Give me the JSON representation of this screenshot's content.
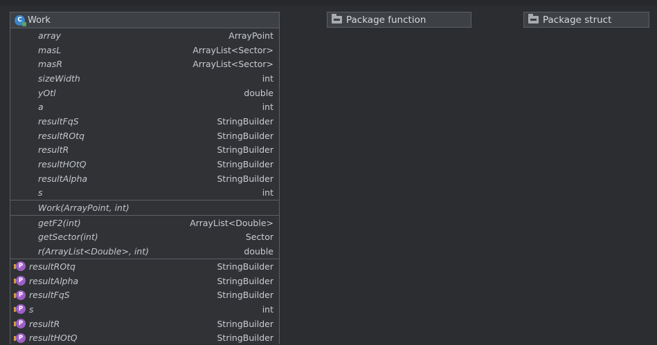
{
  "class": {
    "name": "Work",
    "fields": [
      {
        "name": "array",
        "type": "ArrayPoint"
      },
      {
        "name": "masL",
        "type": "ArrayList<Sector>"
      },
      {
        "name": "masR",
        "type": "ArrayList<Sector>"
      },
      {
        "name": "sizeWidth",
        "type": "int"
      },
      {
        "name": "yOtl",
        "type": "double"
      },
      {
        "name": "a",
        "type": "int"
      },
      {
        "name": "resultFqS",
        "type": "StringBuilder"
      },
      {
        "name": "resultROtq",
        "type": "StringBuilder"
      },
      {
        "name": "resultR",
        "type": "StringBuilder"
      },
      {
        "name": "resultHOtQ",
        "type": "StringBuilder"
      },
      {
        "name": "resultAlpha",
        "type": "StringBuilder"
      },
      {
        "name": "s",
        "type": "int"
      }
    ],
    "constructors": [
      {
        "name": "Work(ArrayPoint, int)",
        "type": ""
      }
    ],
    "methods": [
      {
        "name": "getF2(int)",
        "type": "ArrayList<Double>"
      },
      {
        "name": "getSector(int)",
        "type": "Sector"
      },
      {
        "name": "r(ArrayList<Double>, int)",
        "type": "double"
      }
    ],
    "properties": [
      {
        "name": "resultROtq",
        "type": "StringBuilder"
      },
      {
        "name": "resultAlpha",
        "type": "StringBuilder"
      },
      {
        "name": "resultFqS",
        "type": "StringBuilder"
      },
      {
        "name": "s",
        "type": "int"
      },
      {
        "name": "resultR",
        "type": "StringBuilder"
      },
      {
        "name": "resultHOtQ",
        "type": "StringBuilder"
      }
    ]
  },
  "packages": [
    {
      "label": "Package function"
    },
    {
      "label": "Package struct"
    }
  ],
  "icons": {
    "class": "class-icon",
    "package": "folder-icon",
    "property": "property-icon"
  }
}
